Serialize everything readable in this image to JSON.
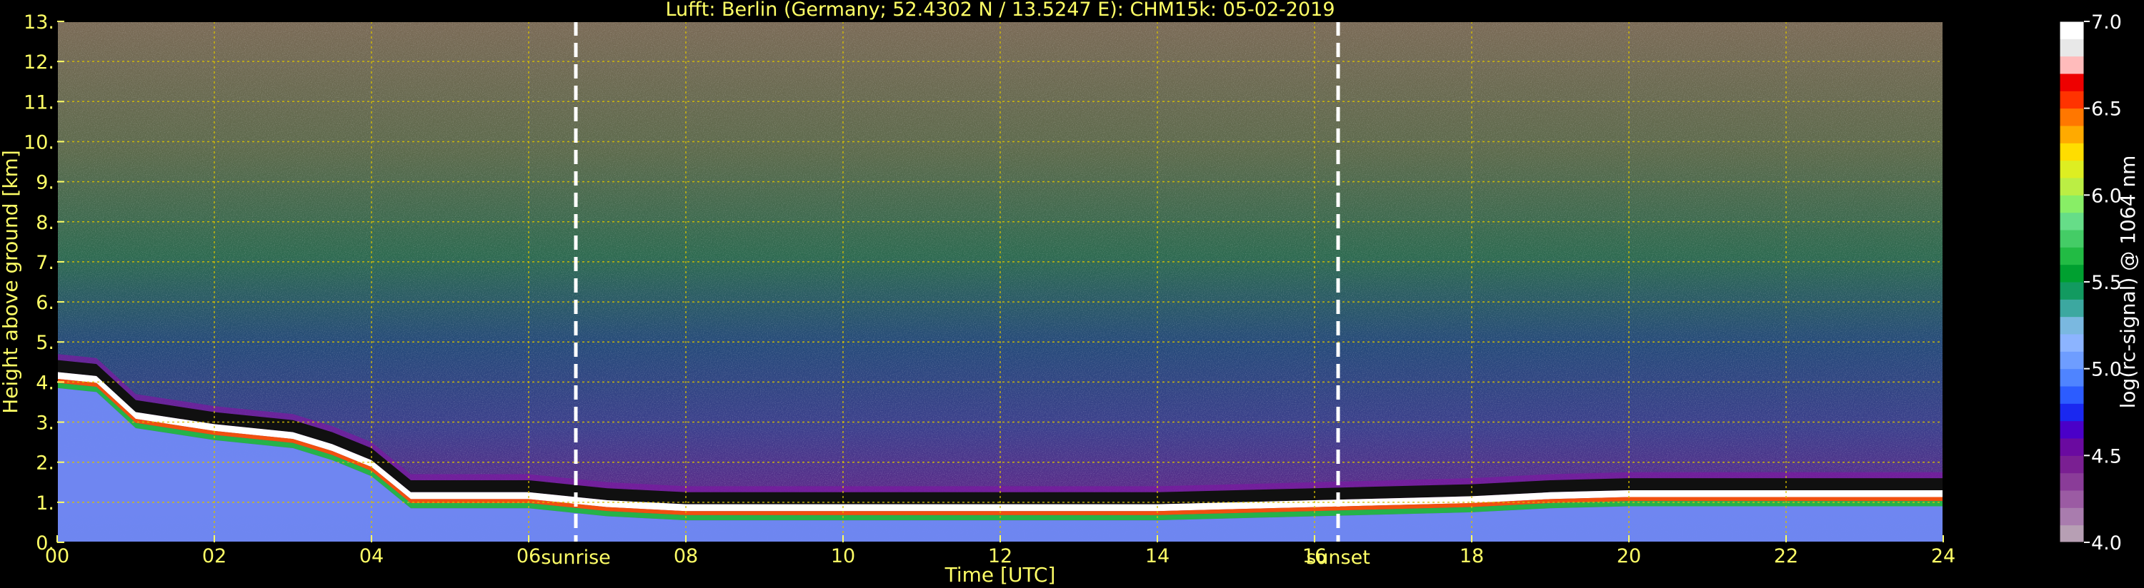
{
  "chart_data": {
    "type": "heatmap",
    "title": "Lufft: Berlin (Germany; 52.4302 N / 13.5247 E):    CHM15k: 05-02-2019",
    "xlabel": "Time [UTC]",
    "ylabel": "Height above ground [km]",
    "xlim": [
      0,
      24
    ],
    "ylim": [
      0,
      13
    ],
    "x_ticks": [
      "00",
      "02",
      "04",
      "06",
      "08",
      "10",
      "12",
      "14",
      "16",
      "18",
      "20",
      "22",
      "24"
    ],
    "y_ticks": [
      "0.",
      "1.",
      "2.",
      "3.",
      "4.",
      "5.",
      "6.",
      "7.",
      "8.",
      "9.",
      "10.",
      "11.",
      "12.",
      "13."
    ],
    "grid": true,
    "annotations": [
      {
        "label": "sunrise",
        "x": 6.6
      },
      {
        "label": "sunset",
        "x": 16.3
      }
    ],
    "colorbar": {
      "label": "log(rc-signal) @ 1064 nm",
      "range": [
        4.0,
        7.0
      ],
      "ticks": [
        "4.0",
        "4.5",
        "5.0",
        "5.5",
        "6.0",
        "6.5",
        "7.0"
      ],
      "colors": [
        "#b79fb4",
        "#a97cae",
        "#9b5ba3",
        "#8a3c98",
        "#7a1f92",
        "#6a0aa0",
        "#4a00c8",
        "#1a28f0",
        "#2c5cff",
        "#4f84ff",
        "#6e9dff",
        "#8cb4ff",
        "#7ab8e0",
        "#3ca8a0",
        "#129a60",
        "#00a030",
        "#22bb44",
        "#44cc66",
        "#66dd88",
        "#88ee66",
        "#bbee44",
        "#ddee22",
        "#ffdd00",
        "#ffaa00",
        "#ff7700",
        "#ff3300",
        "#ee0000",
        "#ffbbbb",
        "#e8e8e8",
        "#ffffff"
      ]
    },
    "boundary_layer_top_km": [
      [
        0.0,
        4.2
      ],
      [
        0.5,
        4.1
      ],
      [
        1.0,
        3.2
      ],
      [
        2.0,
        2.9
      ],
      [
        3.0,
        2.7
      ],
      [
        3.5,
        2.4
      ],
      [
        4.0,
        2.0
      ],
      [
        4.5,
        1.2
      ],
      [
        5.0,
        1.2
      ],
      [
        6.0,
        1.2
      ],
      [
        7.0,
        1.0
      ],
      [
        8.0,
        0.9
      ],
      [
        10.0,
        0.9
      ],
      [
        12.0,
        0.9
      ],
      [
        14.0,
        0.9
      ],
      [
        16.0,
        1.0
      ],
      [
        18.0,
        1.1
      ],
      [
        19.0,
        1.2
      ],
      [
        20.0,
        1.25
      ],
      [
        22.0,
        1.25
      ],
      [
        24.0,
        1.25
      ]
    ]
  }
}
